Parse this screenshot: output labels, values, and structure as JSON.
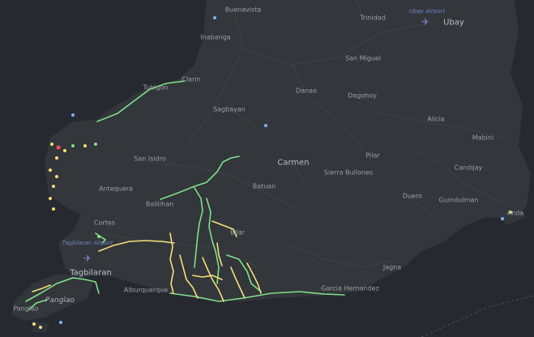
{
  "map": {
    "places": [
      {
        "id": "buenavista",
        "label": "Buenavista"
      },
      {
        "id": "inabanga",
        "label": "Inabanga"
      },
      {
        "id": "trinidad",
        "label": "Trinidad"
      },
      {
        "id": "ubay",
        "label": "Ubay"
      },
      {
        "id": "ubay-airport",
        "label": "Ubay Airport"
      },
      {
        "id": "san-miguel",
        "label": "San Miguel"
      },
      {
        "id": "clarin",
        "label": "Clarin"
      },
      {
        "id": "tubigon",
        "label": "Tubigon"
      },
      {
        "id": "danao",
        "label": "Danao"
      },
      {
        "id": "dagohoy",
        "label": "Dagohoy"
      },
      {
        "id": "sagbayan",
        "label": "Sagbayan"
      },
      {
        "id": "alicia",
        "label": "Alicia"
      },
      {
        "id": "mabini",
        "label": "Mabini"
      },
      {
        "id": "san-isidro",
        "label": "San Isidro"
      },
      {
        "id": "pilar",
        "label": "Pilar"
      },
      {
        "id": "carmen",
        "label": "Carmen"
      },
      {
        "id": "sierra-bullones",
        "label": "Sierra Bullones"
      },
      {
        "id": "candijay",
        "label": "Candijay"
      },
      {
        "id": "antequera",
        "label": "Antequera"
      },
      {
        "id": "batuan",
        "label": "Batuan"
      },
      {
        "id": "duero",
        "label": "Duero"
      },
      {
        "id": "guindulman",
        "label": "Guindulman"
      },
      {
        "id": "balilihan",
        "label": "Balilihan"
      },
      {
        "id": "anda",
        "label": "Anda"
      },
      {
        "id": "cortes",
        "label": "Cortes"
      },
      {
        "id": "tagbilaran-airport",
        "label": "Tagbilaran Airport"
      },
      {
        "id": "bilar",
        "label": "Bilar"
      },
      {
        "id": "tagbilaran",
        "label": "Tagbilaran"
      },
      {
        "id": "jagna",
        "label": "Jagna"
      },
      {
        "id": "alburquerque",
        "label": "Alburquerque"
      },
      {
        "id": "garcia-hernandez",
        "label": "Garcia Hernandez"
      },
      {
        "id": "panglao-island",
        "label": "Panglao"
      },
      {
        "id": "panglao-town",
        "label": "Panglao"
      }
    ],
    "colors": {
      "land": "#33363b",
      "sea": "#262a30",
      "road": "#3e4248",
      "track_green": "#7fe08a",
      "track_yellow": "#f4e07a",
      "poi_blue": "#7fb2ff",
      "poi_red": "#ff4d4d",
      "airport": "#6f86c9"
    },
    "icons": [
      "airplane-icon"
    ]
  }
}
